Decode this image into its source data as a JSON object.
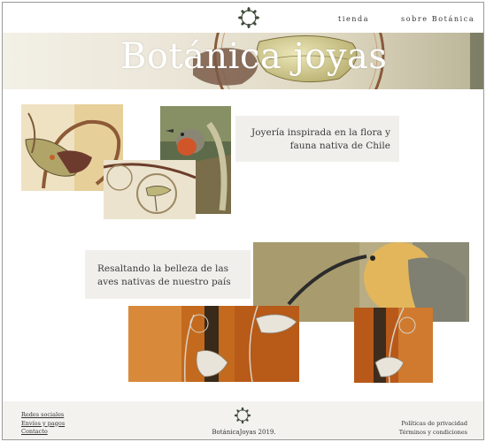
{
  "header": {
    "logo_icon": "wreath-logo-icon",
    "nav": {
      "tienda": "tienda",
      "sobre": "sobre Botánica"
    }
  },
  "hero": {
    "title": "Botánica joyas"
  },
  "section_flora": {
    "text": "Joyería inspirada en la flora y fauna nativa de Chile"
  },
  "section_aves": {
    "text": "Resaltando la belleza de las aves nativas de nuestro país"
  },
  "footer": {
    "links": [
      "Redes sociales",
      "Envíos y pagos",
      "Contacto"
    ],
    "copyright": "BotánicaJoyas 2019.",
    "legal": [
      "Políticas de privacidad",
      "Términos y condiciones"
    ]
  },
  "colors": {
    "footer_bg": "#f3f2ef",
    "card_bg": "#f0efec",
    "accent_green": "#3f5b3a"
  }
}
